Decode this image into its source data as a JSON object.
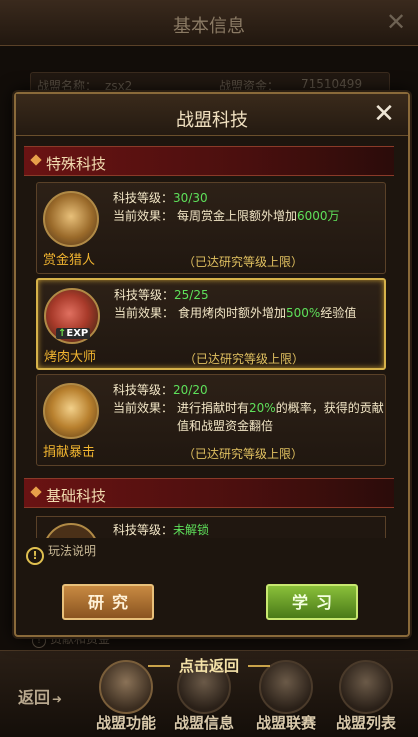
{
  "background": {
    "title": "基本信息",
    "alliance_name_label": "战盟名称：",
    "alliance_name_value": "zsx2",
    "alliance_funds_label": "战盟资金：",
    "alliance_funds_value": "71510499",
    "notice": "贡献和资金"
  },
  "modal": {
    "title": "战盟科技",
    "close_icon": "close-icon"
  },
  "sections": {
    "special": {
      "title": "特殊科技"
    },
    "basic": {
      "title": "基础科技"
    }
  },
  "techs": [
    {
      "name": "赏金猎人",
      "icon": "bounty-hunter-icon",
      "level_label": "科技等级：",
      "level": "30/30",
      "effect_label": "当前效果：",
      "effect_before": "每周赏金上限额外增加",
      "effect_highlight": "6000万",
      "effect_after": "",
      "status": "（已达研究等级上限）"
    },
    {
      "name": "烤肉大师",
      "icon": "roast-meat-icon",
      "badge": "EXP",
      "level_label": "科技等级：",
      "level": "25/25",
      "effect_label": "当前效果：",
      "effect_before": "食用烤肉时额外增加",
      "effect_highlight": "500%",
      "effect_after": "经验值",
      "status": "（已达研究等级上限）"
    },
    {
      "name": "捐献暴击",
      "icon": "donation-crit-icon",
      "level_label": "科技等级：",
      "level": "20/20",
      "effect_label": "当前效果：",
      "effect_before": "进行捐献时有",
      "effect_highlight": "20%",
      "effect_after": "的概率，获得的贡献值和战盟资金翻倍",
      "status": "（已达研究等级上限）"
    }
  ],
  "basic_tech_preview": {
    "level_label": "科技等级：",
    "level": "未解锁"
  },
  "rules_label": "玩法说明",
  "buttons": {
    "research": "研究",
    "learn": "学习"
  },
  "bottom": {
    "back": "返回",
    "tap_return": "点击返回",
    "tabs": [
      "战盟功能",
      "战盟信息",
      "战盟联赛",
      "战盟列表"
    ]
  },
  "colors": {
    "highlight_green": "#5ee05a",
    "name_gold": "#f0b430",
    "section_red": "#6a1313",
    "selected_border": "#d6b24a"
  }
}
